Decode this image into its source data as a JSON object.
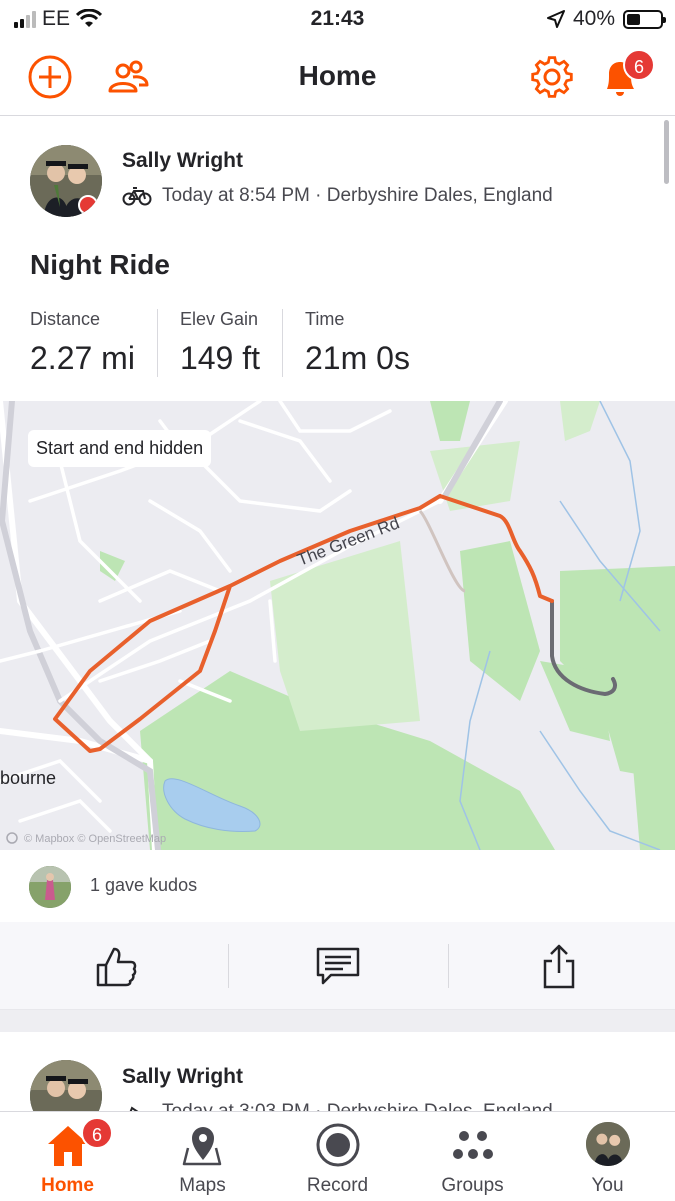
{
  "status_bar": {
    "carrier": "EE",
    "time": "21:43",
    "battery": "40%",
    "battery_level": 0.4
  },
  "header": {
    "title": "Home",
    "notification_count": "6"
  },
  "activity": {
    "athlete": "Sally Wright",
    "meta": "Today at 8:54 PM · Derbyshire Dales, England",
    "title": "Night Ride",
    "stats": [
      {
        "label": "Distance",
        "value": "2.27 mi"
      },
      {
        "label": "Elev Gain",
        "value": "149 ft"
      },
      {
        "label": "Time",
        "value": "21m 0s"
      }
    ],
    "map": {
      "privacy_label": "Start and end hidden",
      "road_label": "The Green Rd",
      "place_label": "bourne",
      "attribution": "© Mapbox © OpenStreetMap"
    },
    "kudos_text": "1 gave kudos"
  },
  "next_activity": {
    "athlete": "Sally Wright",
    "meta": "Today at 3:03 PM · Derbyshire Dales, England"
  },
  "tabbar": {
    "items": [
      {
        "label": "Home",
        "badge": "6"
      },
      {
        "label": "Maps"
      },
      {
        "label": "Record"
      },
      {
        "label": "Groups"
      },
      {
        "label": "You"
      }
    ]
  },
  "colors": {
    "brand": "#fc5200",
    "badge": "#e53935",
    "route": "#e8602c",
    "route_hidden": "#6b6b73"
  }
}
